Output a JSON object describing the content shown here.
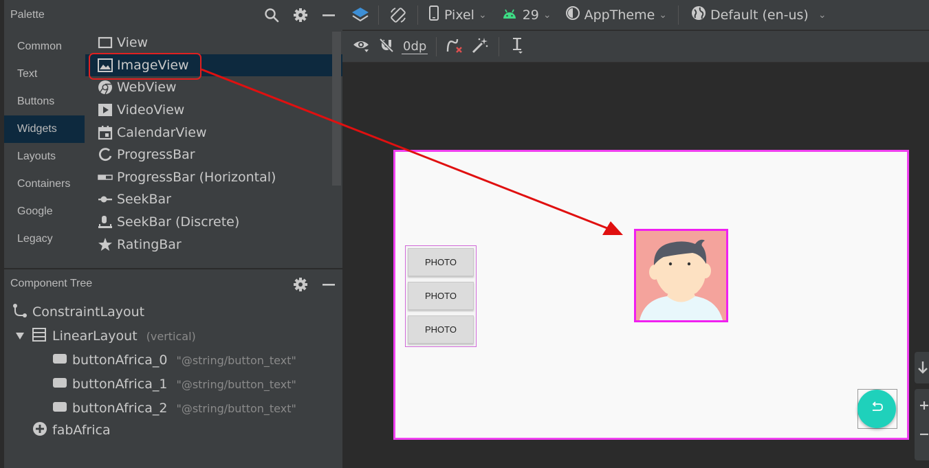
{
  "palette": {
    "title": "Palette",
    "categories": [
      "Common",
      "Text",
      "Buttons",
      "Widgets",
      "Layouts",
      "Containers",
      "Google",
      "Legacy"
    ],
    "selected_category": "Widgets",
    "items": [
      {
        "label": "View",
        "icon": "view-icon"
      },
      {
        "label": "ImageView",
        "icon": "image-icon"
      },
      {
        "label": "WebView",
        "icon": "chrome-icon"
      },
      {
        "label": "VideoView",
        "icon": "play-icon"
      },
      {
        "label": "CalendarView",
        "icon": "calendar-icon"
      },
      {
        "label": "ProgressBar",
        "icon": "progress-ring-icon"
      },
      {
        "label": "ProgressBar (Horizontal)",
        "icon": "progress-bar-icon"
      },
      {
        "label": "SeekBar",
        "icon": "seekbar-icon"
      },
      {
        "label": "SeekBar (Discrete)",
        "icon": "seekbar-discrete-icon"
      },
      {
        "label": "RatingBar",
        "icon": "star-icon"
      }
    ],
    "selected_item": "ImageView"
  },
  "component_tree": {
    "title": "Component Tree",
    "nodes": [
      {
        "label": "ConstraintLayout",
        "hint": ""
      },
      {
        "label": "LinearLayout",
        "hint": "(vertical)"
      },
      {
        "label": "buttonAfrica_0",
        "hint": "\"@string/button_text\""
      },
      {
        "label": "buttonAfrica_1",
        "hint": "\"@string/button_text\""
      },
      {
        "label": "buttonAfrica_2",
        "hint": "\"@string/button_text\""
      },
      {
        "label": "fabAfrica",
        "hint": ""
      }
    ]
  },
  "toolbar": {
    "device": "Pixel",
    "api_level": "29",
    "theme": "AppTheme",
    "locale": "Default (en-us)",
    "margin": "0dp"
  },
  "design": {
    "buttons": [
      "PHOTO",
      "PHOTO",
      "PHOTO"
    ]
  },
  "colors": {
    "annotation": "#e02020",
    "selection": "#f020f0",
    "fab": "#1fd1bb",
    "android_green": "#3ddc84"
  }
}
